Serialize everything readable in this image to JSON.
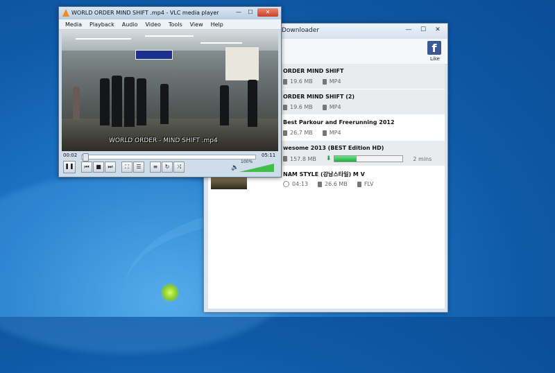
{
  "downloader": {
    "title": "Downloader",
    "facebook_like": "Like",
    "items": [
      {
        "title": "ORDER    MIND SHIFT",
        "size": "19.6 MB",
        "format": "MP4"
      },
      {
        "title": "ORDER    MIND SHIFT  (2)",
        "size": "19.6 MB",
        "format": "MP4"
      },
      {
        "title": "Best Parkour and Freerunning 2012",
        "size": "26.7 MB",
        "format": "MP4"
      },
      {
        "title": "wesome 2013 (BEST Edition HD)",
        "size": "157.8 MB",
        "progress": 0.32,
        "eta": "2 mins"
      },
      {
        "title": "NAM STYLE (강남스타일) M V",
        "duration": "04:13",
        "size": "26.6 MB",
        "format": "FLV"
      }
    ]
  },
  "vlc": {
    "title": "WORLD    ORDER    MIND SHIFT .mp4 - VLC media player",
    "menu": [
      "Media",
      "Playback",
      "Audio",
      "Video",
      "Tools",
      "View",
      "Help"
    ],
    "subtitle": "WORLD ORDER - MIND SHIFT .mp4",
    "time_elapsed": "00:02",
    "time_total": "05:11",
    "seek_fraction": 0.006,
    "volume_label": "100%",
    "volume_fraction": 1.0
  },
  "colors": {
    "vlc_orange": "#f08a1c",
    "facebook_blue": "#3b5998",
    "progress_green": "#1fae3e"
  }
}
